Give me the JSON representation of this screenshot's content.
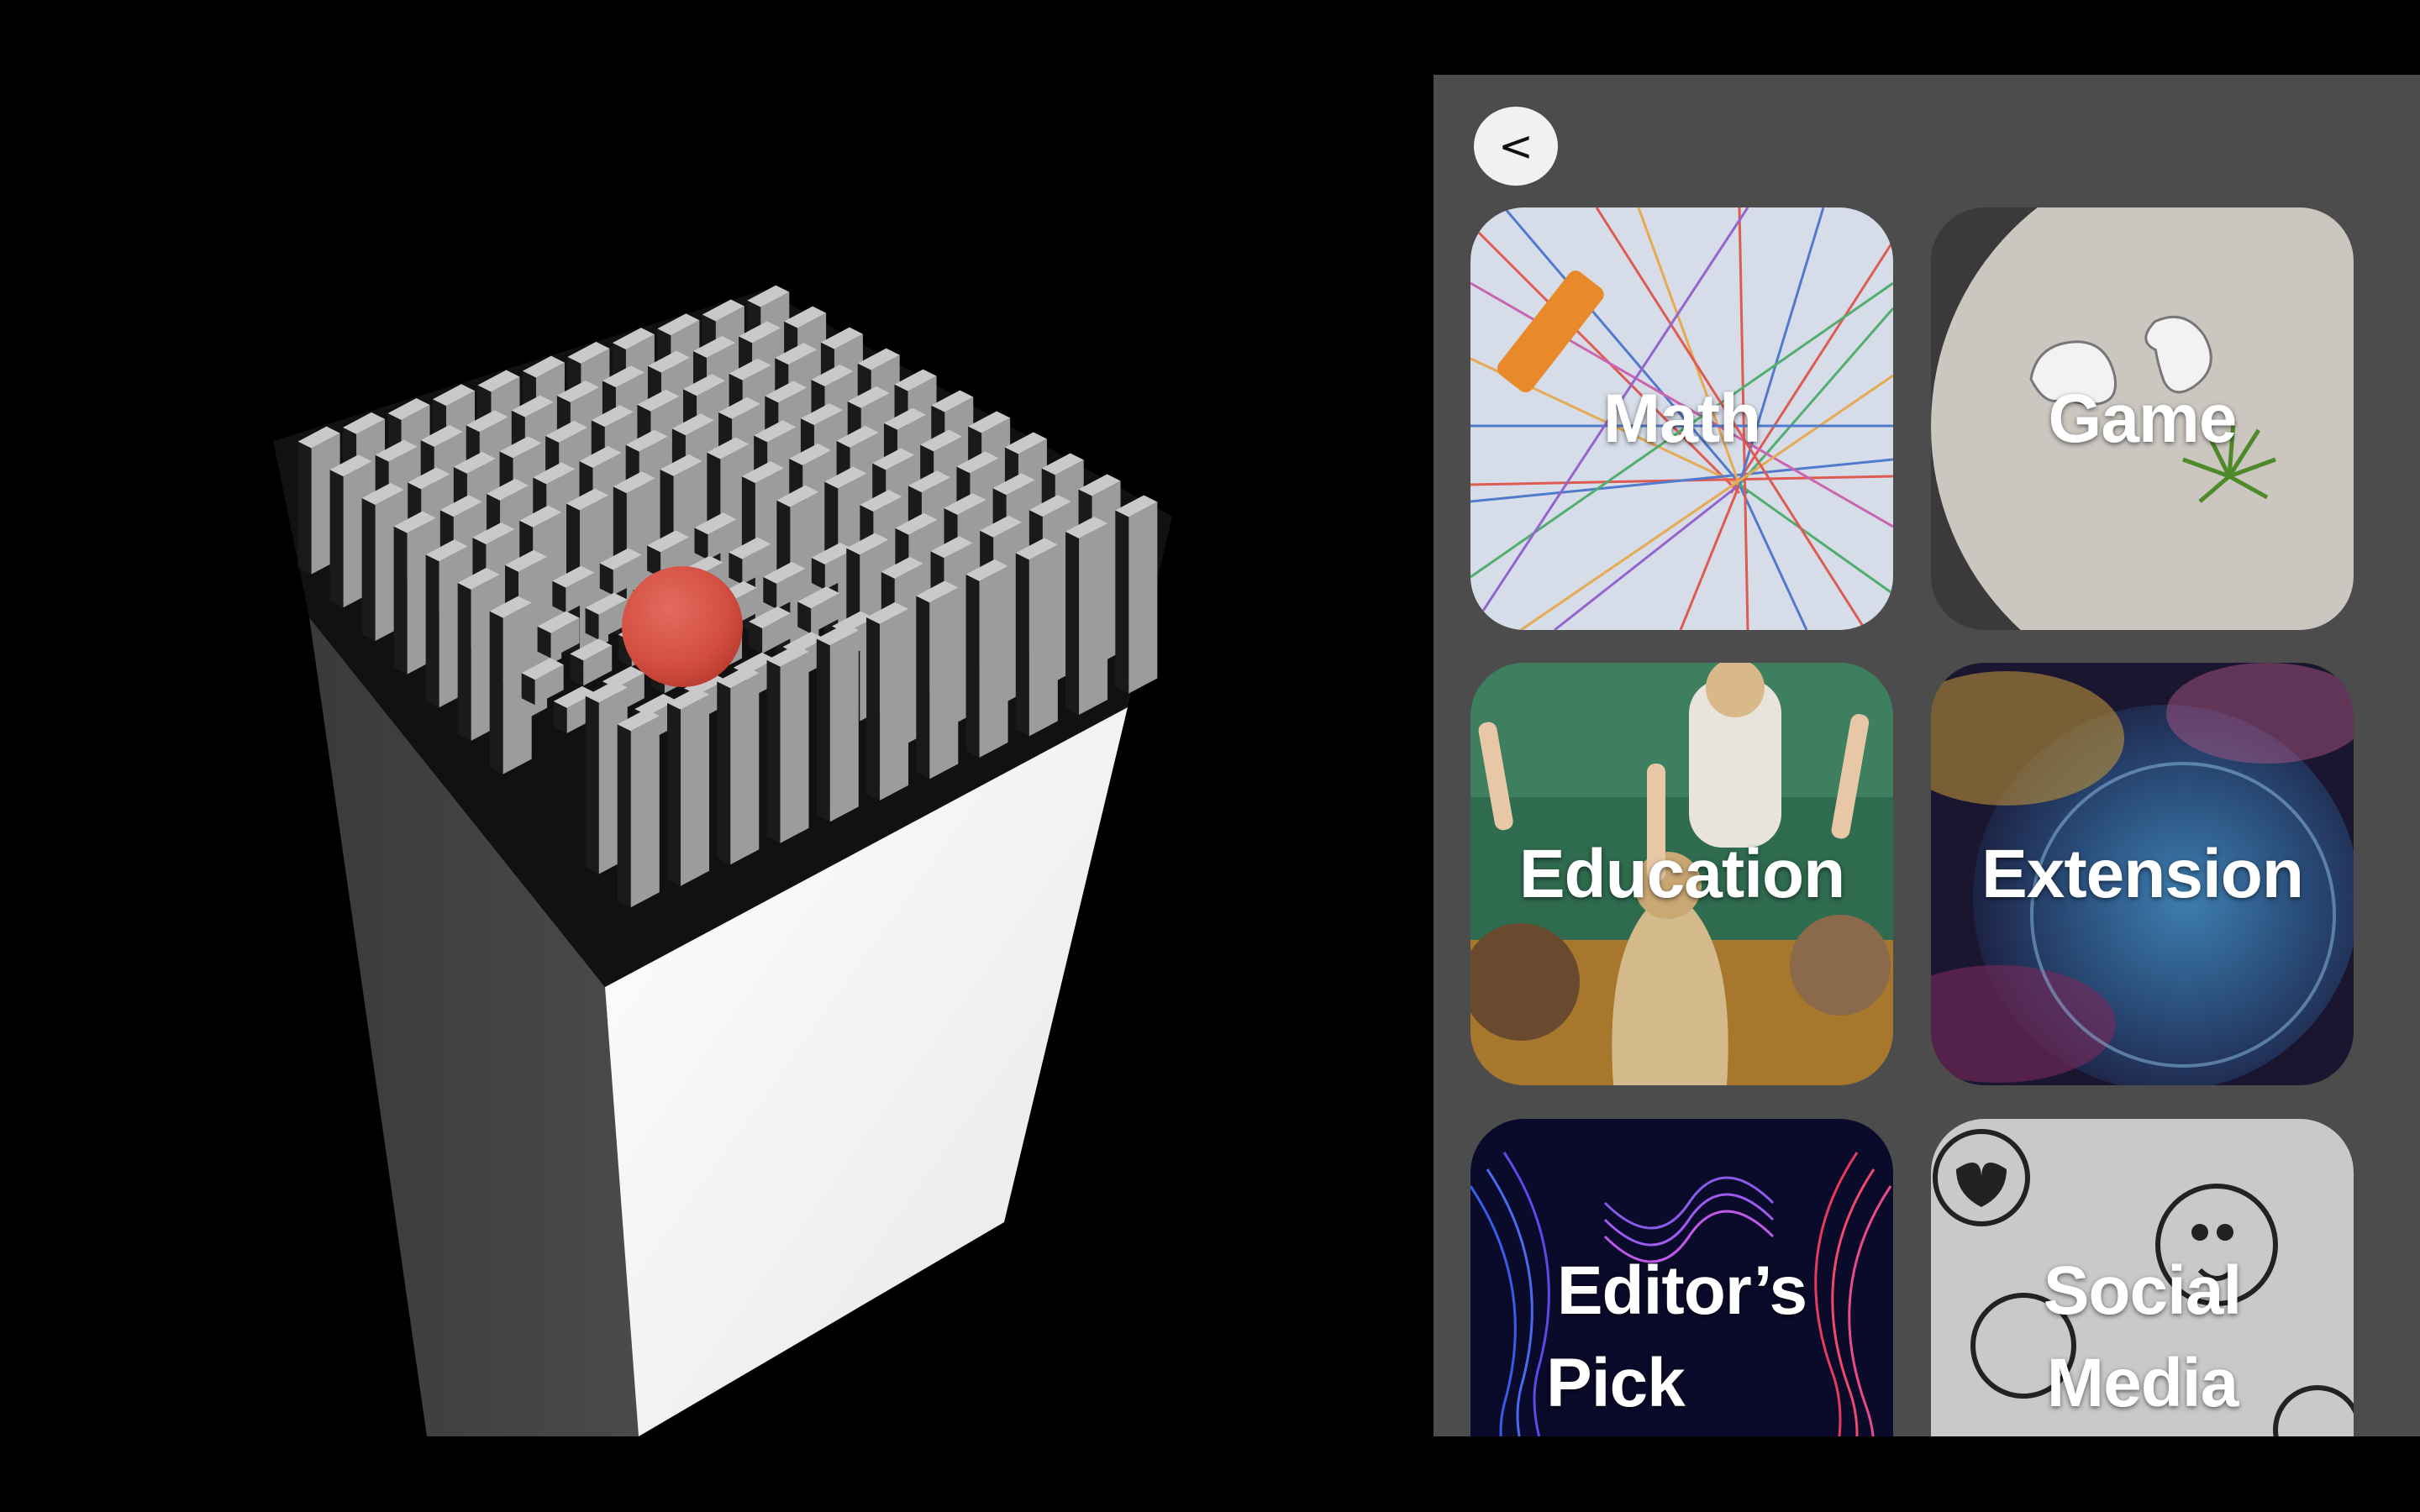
{
  "panel": {
    "back_label": "<"
  },
  "tiles": [
    {
      "label": "Math",
      "image": "string-art-photo"
    },
    {
      "label": "Game",
      "image": "game-controllers-photo"
    },
    {
      "label": "Education",
      "image": "classroom-photo"
    },
    {
      "label": "Extension",
      "image": "nebula-photo"
    },
    {
      "label_line1": "Editor’s",
      "label_line2": "Pick",
      "image": "light-waves-photo"
    },
    {
      "label_line1": "Social",
      "label_line2": "Media",
      "image": "emoji-wall-photo"
    }
  ],
  "scene": {
    "description_icon": "cube-maze-3d",
    "ball_color": "#d9574a",
    "pillar_color": "#b9b9b9"
  }
}
